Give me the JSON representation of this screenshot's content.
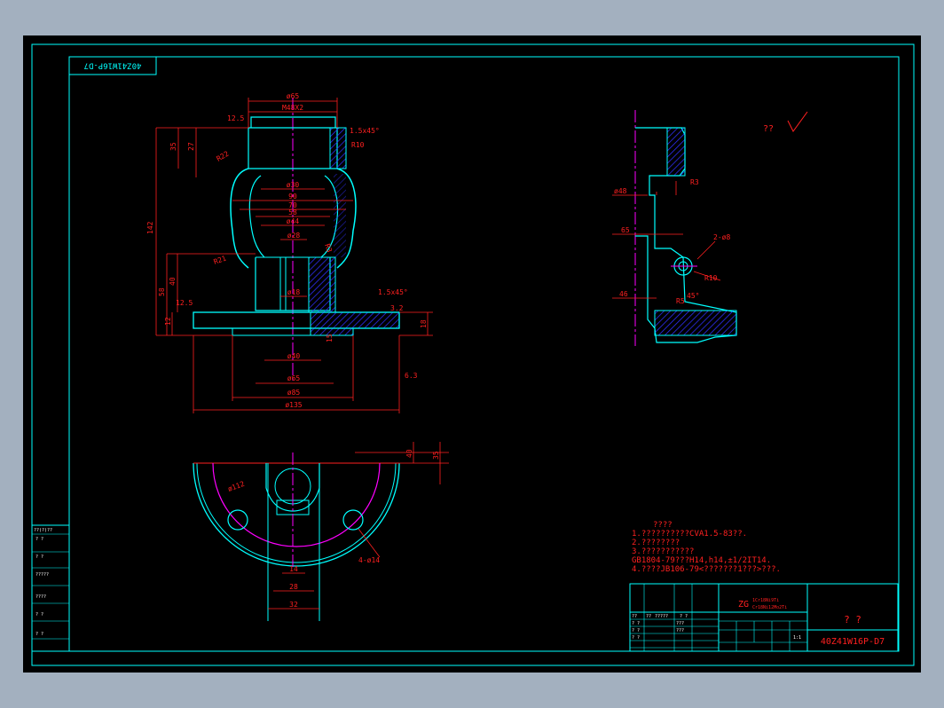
{
  "colors": {
    "background": "#000000",
    "frame": "#00ffff",
    "outline": "#00ffff",
    "centerline": "#ff00ff",
    "dimension": "#ff2020",
    "hatch": "#3030ff",
    "note": "#ff2020",
    "app_bg": "#a3b0bf"
  },
  "top_label": "40Z41W16P-D7",
  "front_view": {
    "dims_top": [
      "ø65",
      "M48X2",
      "1.5x45°",
      "R10"
    ],
    "dims_body": [
      "ø30",
      "90",
      "70",
      "58",
      "ø44",
      "ø28",
      "ø18",
      "ø40",
      "ø65",
      "ø85",
      "ø135"
    ],
    "dims_left": [
      "142",
      "35",
      "27",
      "58",
      "40",
      "12",
      "R22",
      "R21"
    ],
    "dims_right": [
      "1.5x45°",
      "R3",
      "18",
      "15",
      "12.5"
    ],
    "finish": [
      "12.5",
      "6.3",
      "3.2"
    ]
  },
  "side_view": {
    "dims": [
      "ø48",
      "65",
      "46",
      "2-ø8",
      "R10",
      "R5",
      "45°",
      "R3"
    ]
  },
  "bottom_view": {
    "dims": [
      "40",
      "35",
      "ø112",
      "4-ø14",
      "14",
      "28",
      "32"
    ]
  },
  "roughness_note": "?? ",
  "notes": {
    "title": "????",
    "lines": [
      "1.??????????CVA1.5-83??.",
      "2.????????",
      "3.???????????",
      "GB1804-79???H14,h14,±1/2IT14.",
      "4.????JB106-79<???????1???>???."
    ]
  },
  "title_block": {
    "material": "ZG",
    "material_spec_1": "1Cr18Ni9Ti",
    "material_spec_2": "Cr18Ni12Mo2Ti",
    "part_name": "?  ?",
    "drawing_no": "40Z41W16P-D7",
    "cells": [
      "?? ",
      "?? ",
      "?????",
      "? ?",
      "? ?",
      "? ?",
      "? ?",
      "???",
      "???",
      "1:1"
    ]
  },
  "side_table": {
    "rows": [
      "??(?)??",
      "?  ?",
      "?  ?",
      "?????",
      "????",
      "?  ?",
      "?  ?"
    ]
  }
}
